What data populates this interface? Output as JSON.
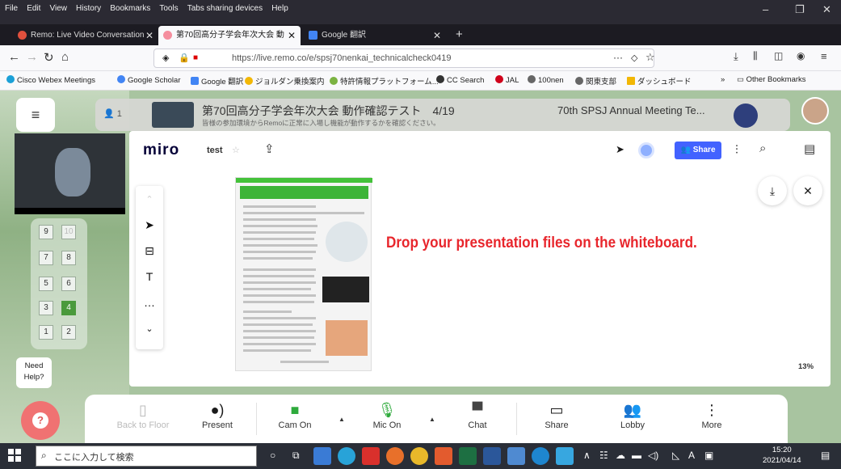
{
  "menubar": {
    "items": [
      "File",
      "Edit",
      "View",
      "History",
      "Bookmarks",
      "Tools",
      "Tabs sharing devices",
      "Help"
    ]
  },
  "tabs": [
    {
      "label": "Remo: Live Video Conversation",
      "color": "#e0503d"
    },
    {
      "label": "第70回高分子学会年次大会 動",
      "color": "#f58e9e"
    },
    {
      "label": "Google 翻訳",
      "color": "#4285f4"
    }
  ],
  "address": {
    "url": "https://live.remo.co/e/spsj70nenkai_technicalcheck0419",
    "more": "···"
  },
  "bookmarks": [
    "Cisco Webex Meetings",
    "Google Scholar",
    "Google 翻訳",
    "ジョルダン乗換案内",
    "特許情報プラットフォーム...",
    "CC Search",
    "JAL",
    "100nen",
    "関東支部",
    "ダッシュボード"
  ],
  "bookmarks_other": "Other Bookmarks",
  "header": {
    "count": "1",
    "title": "第70回高分子学会年次大会 動作確認テスト　4/19",
    "subtitle": "皆様の参加環境からRemoに正常に入場し機能が動作するかを確認ください。",
    "right_title": "70th SPSJ Annual Meeting Te..."
  },
  "floors": [
    [
      "9",
      "10"
    ],
    [
      "7",
      "8"
    ],
    [
      "5",
      "6"
    ],
    [
      "3",
      "4"
    ],
    [
      "1",
      "2"
    ]
  ],
  "miro": {
    "logo": "miro",
    "board_name": "test",
    "share": "Share",
    "drop_message": "Drop your presentation files on the whiteboard.",
    "zoom": "13%"
  },
  "help": {
    "line1": "Need",
    "line2": "Help?"
  },
  "bottom": {
    "back": "Back to Floor",
    "present": "Present",
    "cam": "Cam On",
    "mic": "Mic On",
    "chat": "Chat",
    "share": "Share",
    "lobby": "Lobby",
    "more": "More"
  },
  "taskbar": {
    "search_placeholder": "ここに入力して検索",
    "time": "15:20",
    "date": "2021/04/14",
    "ime": "A"
  }
}
